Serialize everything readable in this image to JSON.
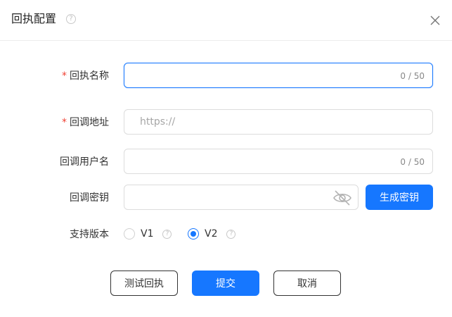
{
  "dialog": {
    "title": "回执配置",
    "help_glyph": "?",
    "close_icon": "close-icon"
  },
  "form": {
    "receipt_name": {
      "label": "回执名称",
      "required": "*",
      "value": "",
      "placeholder": "",
      "counter": "0 / 50"
    },
    "callback_url": {
      "label": "回调地址",
      "required": "*",
      "value": "",
      "placeholder": "https://"
    },
    "callback_username": {
      "label": "回调用户名",
      "value": "",
      "placeholder": "",
      "counter": "0 / 50"
    },
    "callback_secret": {
      "label": "回调密钥",
      "value": "",
      "placeholder": "",
      "visibility_icon": "eye-off-icon",
      "generate_label": "生成密钥"
    },
    "version": {
      "label": "支持版本",
      "options": [
        {
          "label": "V1",
          "checked": false
        },
        {
          "label": "V2",
          "checked": true
        }
      ],
      "help_glyph": "?"
    }
  },
  "actions": {
    "test_label": "测试回执",
    "submit_label": "提交",
    "cancel_label": "取消"
  },
  "colors": {
    "primary": "#1677ff",
    "required": "#f04134",
    "border": "#dcdcdc"
  }
}
